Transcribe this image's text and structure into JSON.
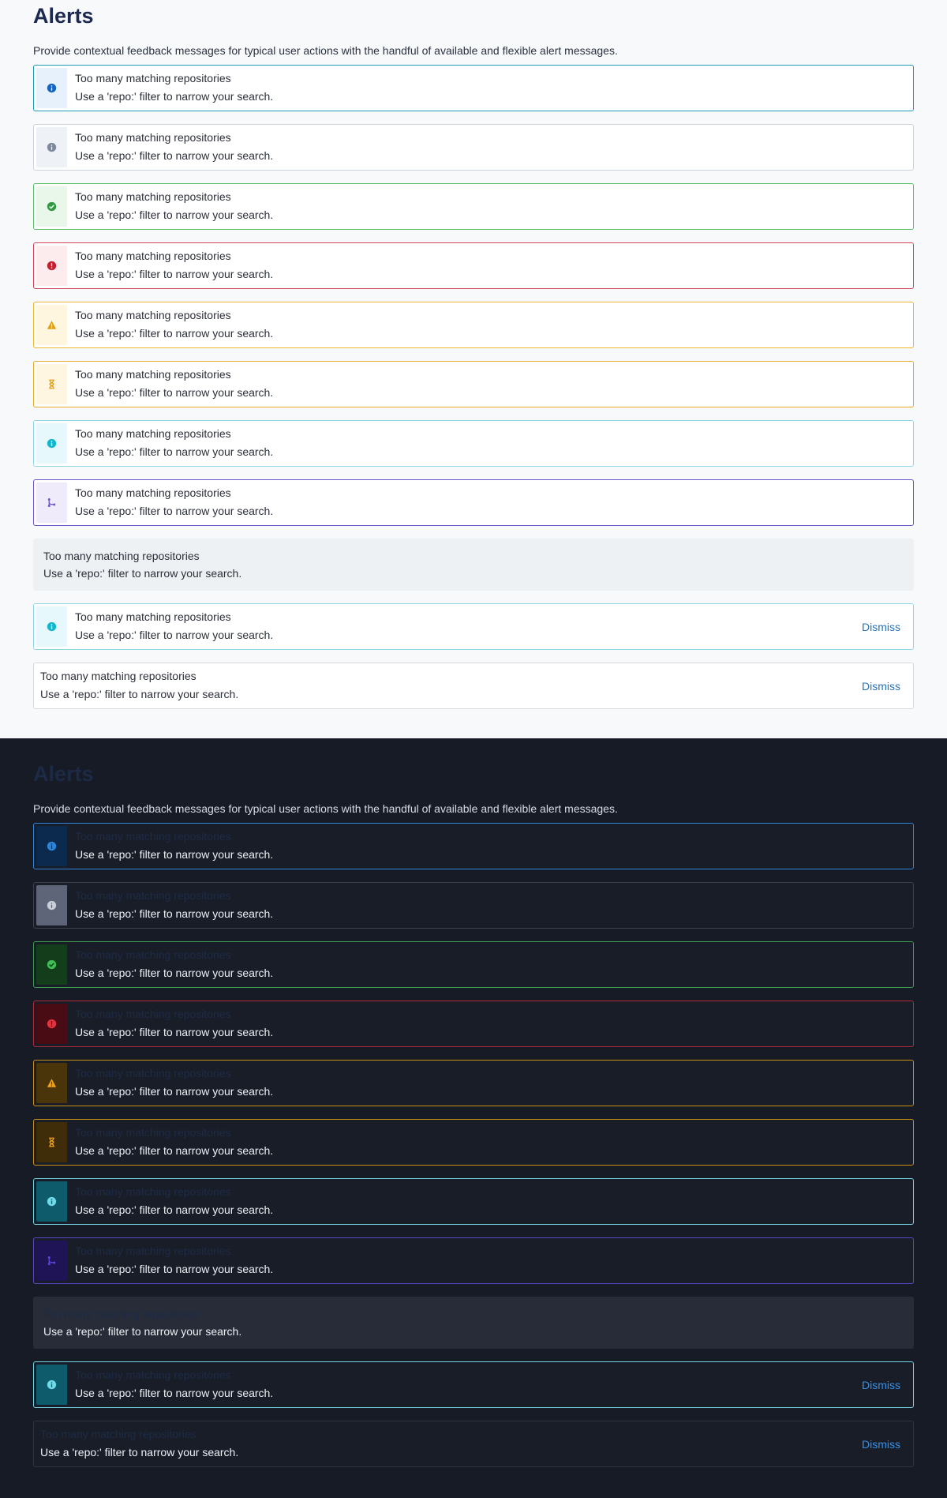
{
  "title": "Alerts",
  "description": "Provide contextual feedback messages for typical user actions with the handful of available and flexible alert messages.",
  "alert": {
    "title": "Too many matching repositories",
    "body": "Use a 'repo:' filter to narrow your search.",
    "dismiss": "Dismiss"
  },
  "variants": [
    {
      "name": "primary",
      "icon": "info-icon",
      "color_light": "#1565c0",
      "color_dark": "#2f84d8"
    },
    {
      "name": "secondary",
      "icon": "info-icon",
      "color_light": "#7d889c",
      "color_dark": "#c9ced8"
    },
    {
      "name": "success",
      "icon": "check-circle-icon",
      "color_light": "#2f9a42",
      "color_dark": "#3fbf56"
    },
    {
      "name": "danger",
      "icon": "error-icon",
      "color_light": "#c41f30",
      "color_dark": "#e0323f"
    },
    {
      "name": "warning",
      "icon": "warning-icon",
      "color_light": "#e09e10",
      "color_dark": "#f0a31c"
    },
    {
      "name": "pending",
      "icon": "hourglass-icon",
      "color_light": "#e09e10",
      "color_dark": "#f0a31c"
    },
    {
      "name": "info",
      "icon": "info-icon",
      "color_light": "#14b6cc",
      "color_dark": "#6fd9e8"
    },
    {
      "name": "merge",
      "icon": "merge-icon",
      "color_light": "#6a56d0",
      "color_dark": "#5a46e0"
    }
  ]
}
